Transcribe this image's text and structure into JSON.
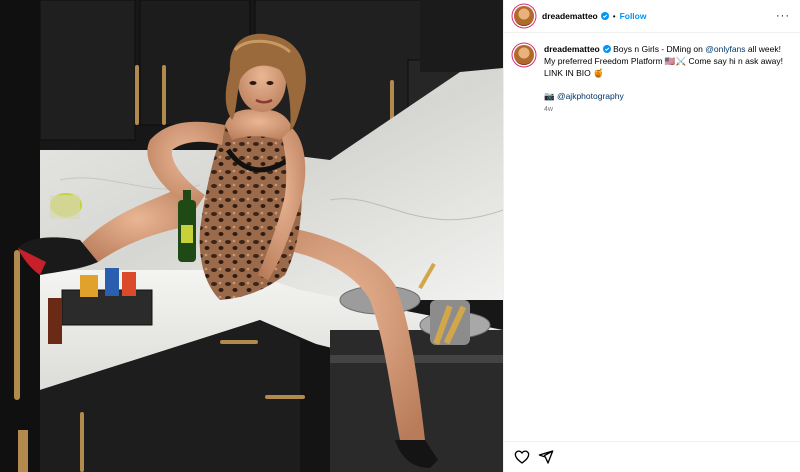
{
  "post": {
    "username": "dreadematteo",
    "separator": "•",
    "follow_label": "Follow",
    "more_label": "···",
    "caption": {
      "text_part1": "Boys n Girls - DMing on ",
      "mention_onlyfans": "@onlyfans",
      "text_part2": " all week! My preferred Freedom Platform 🇺🇸⚔️  Come say hi n ask away! LINK IN BIO 🍯",
      "credit_prefix": "📷 ",
      "credit_mention": "@ajkphotography",
      "time": "4w"
    }
  },
  "image": {
    "description_icon": "photo"
  },
  "icons": {
    "verified": "verified-badge-icon",
    "like": "heart-icon",
    "share": "paper-plane-icon"
  },
  "colors": {
    "follow": "#0095f6",
    "mention": "#00376b",
    "verified": "#0095f6",
    "muted": "#737373"
  }
}
